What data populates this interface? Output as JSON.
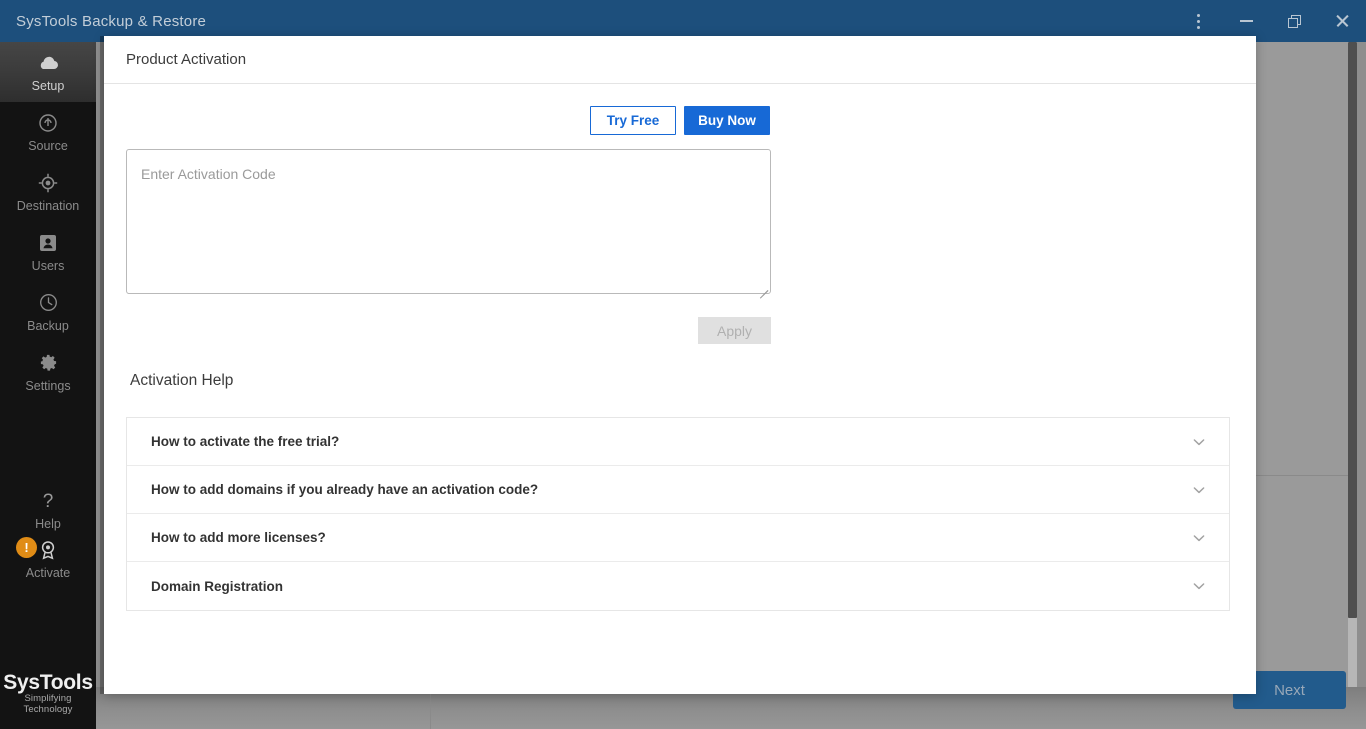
{
  "titlebar": {
    "title": "SysTools Backup & Restore",
    "controls": [
      {
        "name": "more-options",
        "icon": "vertical-dots-icon"
      },
      {
        "name": "minimize",
        "icon": "minimize-icon"
      },
      {
        "name": "restore",
        "icon": "restore-icon"
      },
      {
        "name": "close",
        "icon": "close-icon"
      }
    ],
    "accent_color": "#1d4f7c"
  },
  "sidebar": {
    "items": [
      {
        "label": "Setup",
        "icon": "cloud-icon",
        "active": true
      },
      {
        "label": "Source",
        "icon": "source-circle-icon",
        "active": false
      },
      {
        "label": "Destination",
        "icon": "target-icon",
        "active": false
      },
      {
        "label": "Users",
        "icon": "user-card-icon",
        "active": false
      },
      {
        "label": "Backup",
        "icon": "clock-icon",
        "active": false
      },
      {
        "label": "Settings",
        "icon": "gear-icon",
        "active": false
      }
    ],
    "help": {
      "label": "Help",
      "icon": "question-mark-icon"
    },
    "activate": {
      "label": "Activate",
      "icon": "award-icon",
      "badge": "!",
      "badge_color": "#e08c16"
    },
    "brand": {
      "name": "SysTools",
      "registered": "®",
      "tagline": "Simplifying Technology"
    }
  },
  "background": {
    "next_label": "Next"
  },
  "modal": {
    "title": "Product Activation",
    "buttons": {
      "try_free": "Try Free",
      "buy_now": "Buy Now"
    },
    "activation_code": {
      "value": "",
      "placeholder": "Enter Activation Code"
    },
    "apply_label": "Apply",
    "help_section_title": "Activation Help",
    "help_items": [
      {
        "label": "How to activate the free trial?",
        "icon": "chevron-down-icon"
      },
      {
        "label": "How to add domains if you already have an activation code?",
        "icon": "chevron-down-icon"
      },
      {
        "label": "How to add more licenses?",
        "icon": "chevron-down-icon"
      },
      {
        "label": "Domain Registration",
        "icon": "chevron-down-icon"
      }
    ],
    "colors": {
      "primary": "#1769d6",
      "disabled": "#e0e0e0"
    }
  }
}
